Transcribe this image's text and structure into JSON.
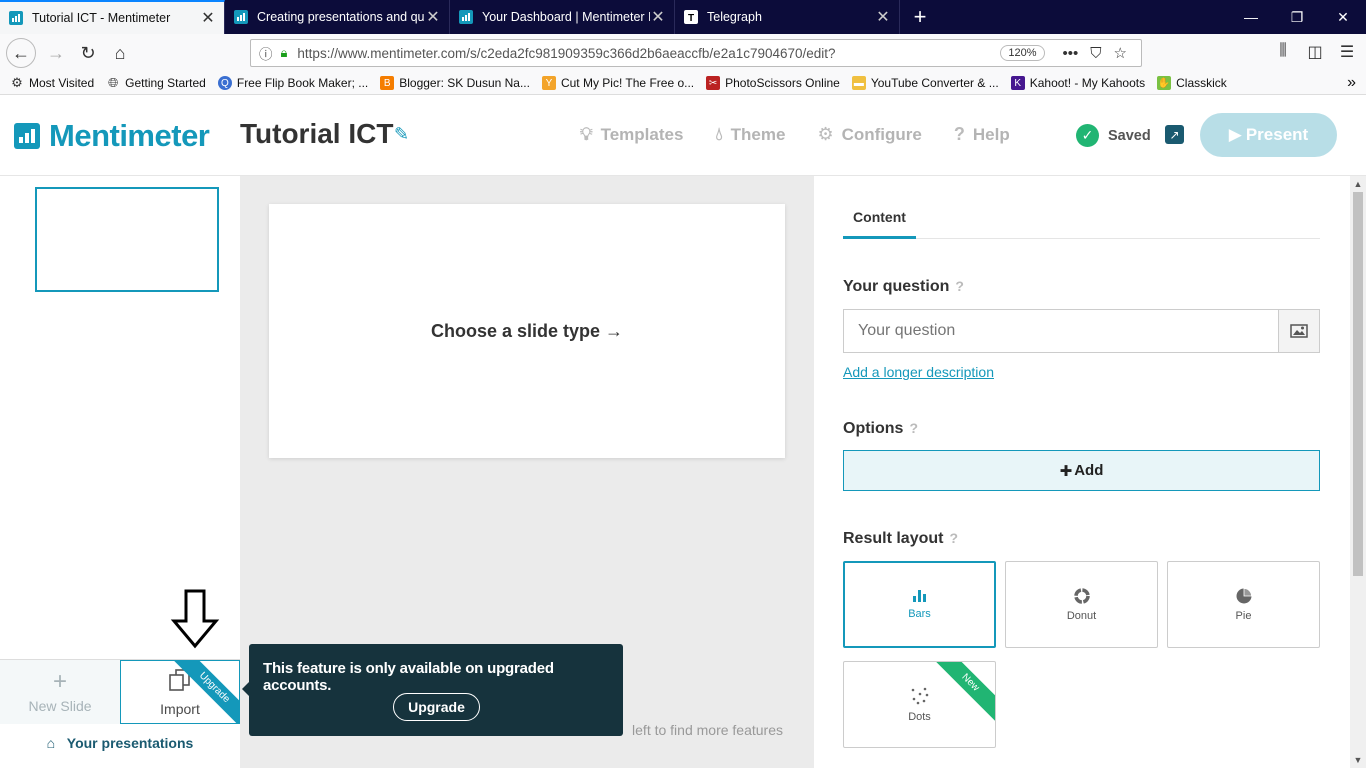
{
  "browser": {
    "tabs": [
      {
        "title": "Tutorial ICT - Mentimeter",
        "active": true,
        "icon": "mentimeter-icon"
      },
      {
        "title": "Creating presentations and qu",
        "active": false,
        "icon": "mentimeter-icon"
      },
      {
        "title": "Your Dashboard | Mentimeter H",
        "active": false,
        "icon": "mentimeter-icon"
      },
      {
        "title": "Telegraph",
        "active": false,
        "icon": "telegraph-icon"
      }
    ],
    "url": "https://www.mentimeter.com/s/c2eda2fc981909359c366d2b6aeaccfb/e2a1c7904670/edit?",
    "zoom": "120%",
    "bookmarks": [
      "Most Visited",
      "Getting Started",
      "Free Flip Book Maker; ...",
      "Blogger: SK Dusun Na...",
      "Cut My Pic! The Free o...",
      "PhotoScissors Online",
      "YouTube Converter & ...",
      "Kahoot! - My Kahoots",
      "Classkick"
    ]
  },
  "header": {
    "logo": "Mentimeter",
    "title": "Tutorial ICT",
    "nav": [
      "Templates",
      "Theme",
      "Configure",
      "Help"
    ],
    "saved": "Saved",
    "present": "Present"
  },
  "sidebar": {
    "new_slide": "New Slide",
    "import": "Import",
    "upgrade_ribbon": "Upgrade",
    "your_presentations": "Your presentations"
  },
  "canvas": {
    "slide_prompt": "Choose a slide type →",
    "hint": "left to find more features",
    "tooltip": {
      "message": "This feature is only available on upgraded accounts.",
      "button": "Upgrade"
    }
  },
  "panel": {
    "tab": "Content",
    "question_label": "Your question",
    "question_placeholder": "Your question",
    "description_link": "Add a longer description",
    "options_label": "Options",
    "add_label": "Add",
    "result_layout_label": "Result layout",
    "layouts": [
      "Bars",
      "Donut",
      "Pie",
      "Dots"
    ],
    "new_ribbon": "New"
  },
  "colors": {
    "brand": "#1498ba",
    "tooltip_bg": "#16333d",
    "success": "#21b573"
  }
}
